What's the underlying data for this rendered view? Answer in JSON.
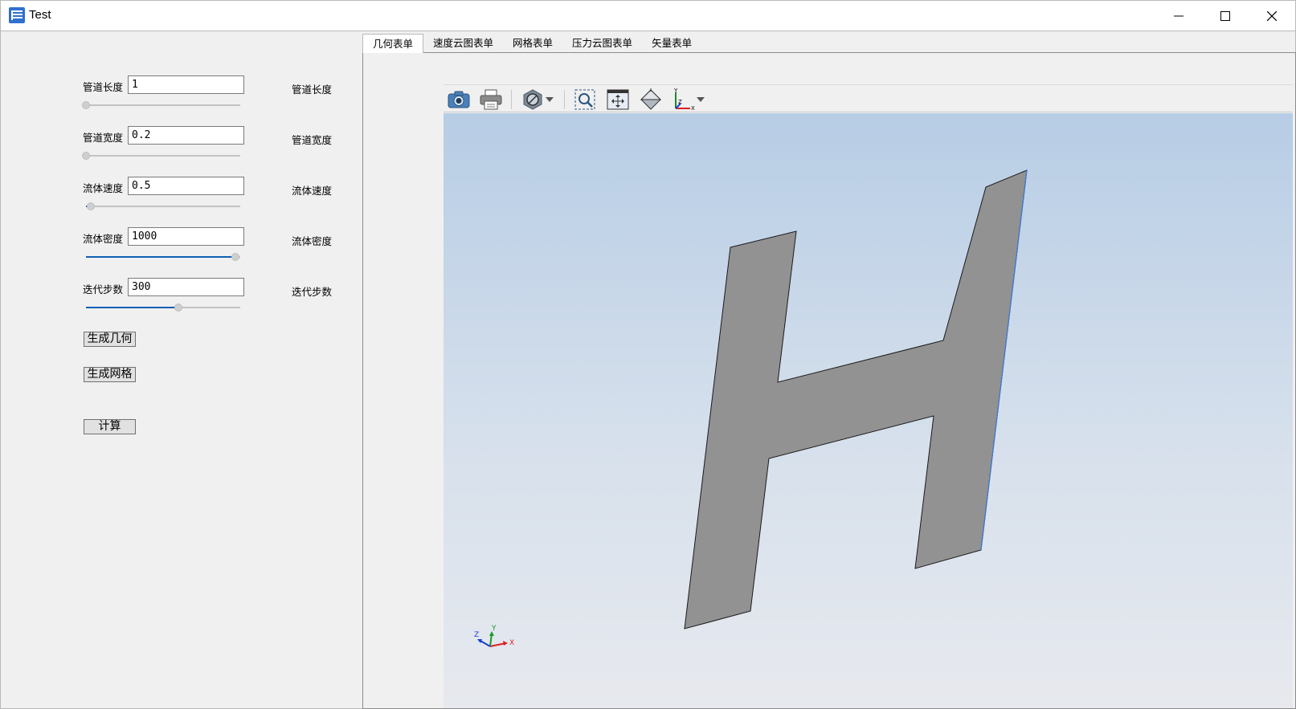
{
  "window": {
    "title": "Test",
    "icon": "app-icon",
    "controls": [
      "minimize-icon",
      "maximize-icon",
      "close-icon"
    ]
  },
  "params": [
    {
      "label": "管道长度",
      "value": "1",
      "echo": "管道长度",
      "slider_fraction": 0.0
    },
    {
      "label": "管道宽度",
      "value": "0.2",
      "echo": "管道宽度",
      "slider_fraction": 0.0
    },
    {
      "label": "流体速度",
      "value": "0.5",
      "echo": "流体速度",
      "slider_fraction": 0.03
    },
    {
      "label": "流体密度",
      "value": "1000",
      "echo": "流体密度",
      "slider_fraction": 0.97
    },
    {
      "label": "迭代步数",
      "value": "300",
      "echo": "迭代步数",
      "slider_fraction": 0.6
    }
  ],
  "buttons": {
    "geometry": "生成几何",
    "mesh": "生成网格",
    "compute": "计算"
  },
  "tabs": [
    "几何表单",
    "速度云图表单",
    "网格表单",
    "压力云图表单",
    "矢量表单"
  ],
  "active_tab": 0,
  "toolbar": [
    "camera-icon",
    "print-icon",
    "display-mode-icon",
    "dropdown-arrow-icon",
    "zoom-window-icon",
    "fit-all-icon",
    "iso-view-icon",
    "axes-view-icon",
    "dropdown-arrow-icon"
  ],
  "colors": {
    "accent": "#0e5fb5",
    "shape_fill": "#929292",
    "viewport_top": "#b7cde5",
    "viewport_bottom": "#e7e9ee"
  },
  "axis_triad": {
    "x": "X",
    "y": "Y",
    "z": "Z"
  }
}
